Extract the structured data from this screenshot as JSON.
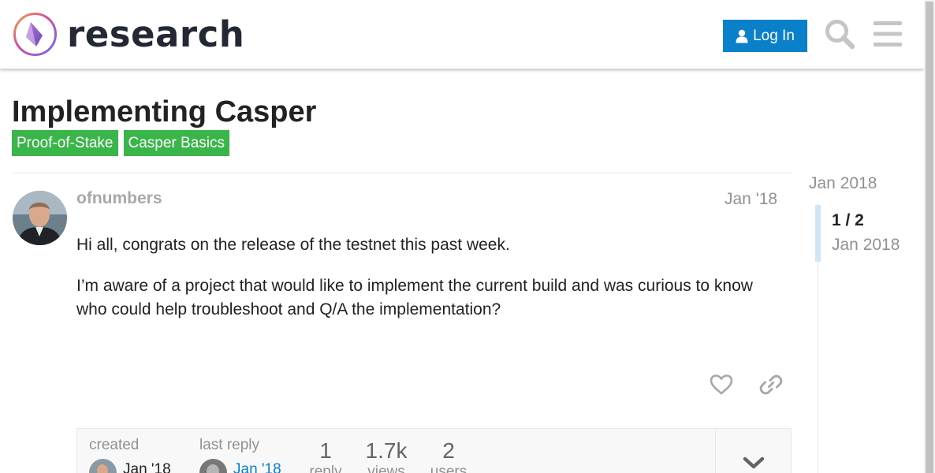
{
  "header": {
    "logo_text": "research",
    "login_label": "Log In",
    "search_icon": "search-icon",
    "menu_icon": "hamburger-menu-icon",
    "accent_color": "#0a7fca"
  },
  "topic": {
    "title": "Implementing Casper",
    "tags": [
      "Proof-of-Stake",
      "Casper Basics"
    ],
    "tag_color": "#3ab54a"
  },
  "post": {
    "username": "ofnumbers",
    "date": "Jan '18",
    "paragraphs": [
      "Hi all, congrats on the release of the testnet this past week.",
      "I’m aware of a project that would like to implement the current build and was curious to know who could help troubleshoot and Q/A the implementation?"
    ],
    "like_icon": "heart-icon",
    "share_icon": "link-icon"
  },
  "topic_map": {
    "created_label": "created",
    "created_date": "Jan '18",
    "last_reply_label": "last reply",
    "last_reply_date": "Jan '18",
    "replies_count": "1",
    "replies_label": "reply",
    "views_count": "1.7k",
    "views_label": "views",
    "users_count": "2",
    "users_label": "users",
    "expand_icon": "chevron-down-icon"
  },
  "timeline": {
    "start_label": "Jan 2018",
    "counter": "1 / 2",
    "current_date": "Jan 2018"
  }
}
